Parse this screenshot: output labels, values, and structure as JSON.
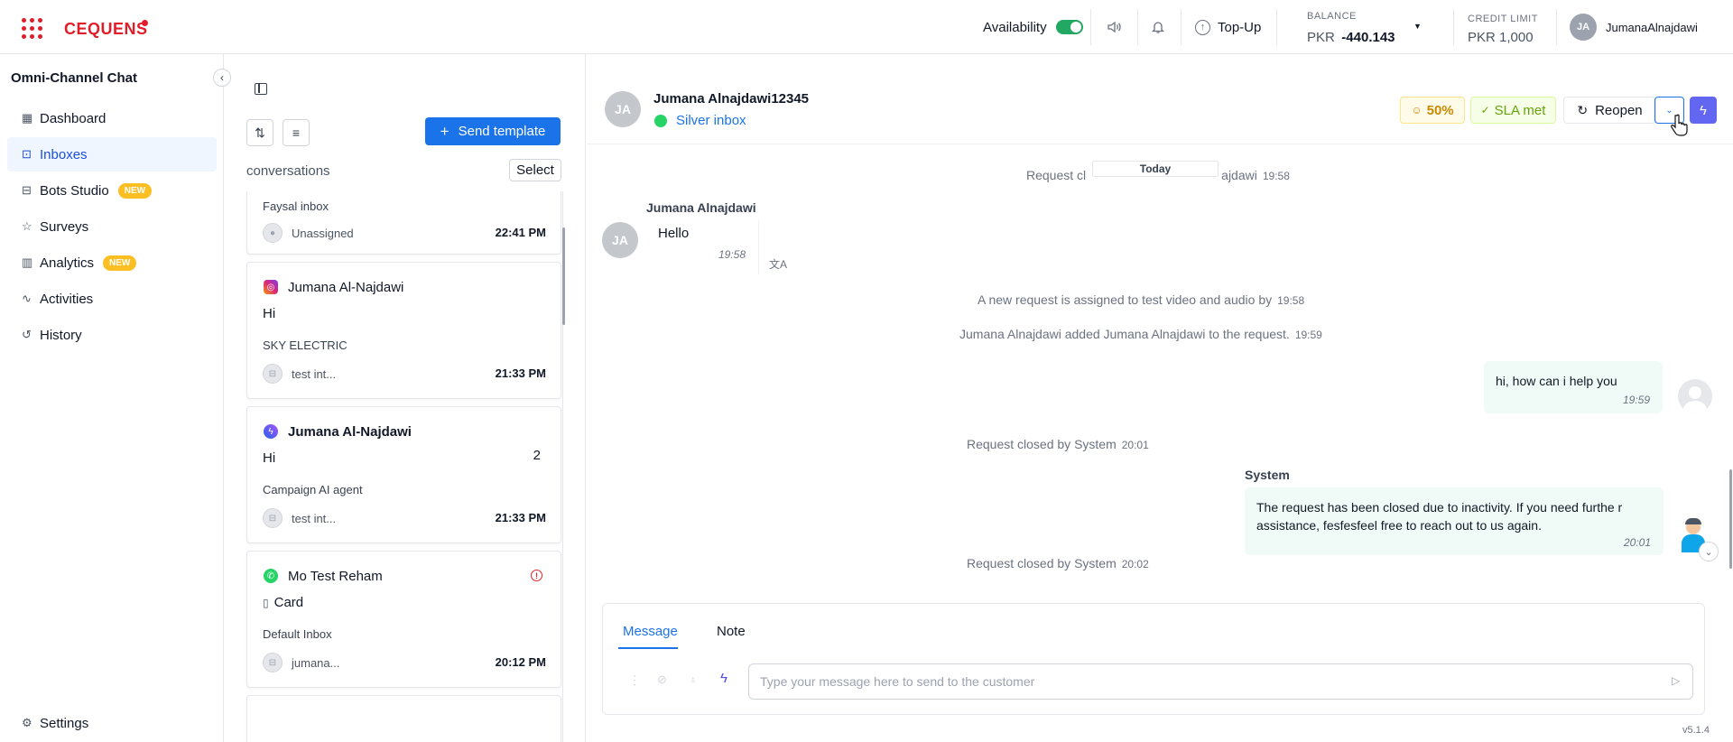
{
  "brand": {
    "name": "CEQUENS"
  },
  "topbar": {
    "availability_label": "Availability",
    "topup_label": "Top-Up",
    "balance_label": "BALANCE",
    "balance_currency": "PKR",
    "balance_value": "-440.143",
    "credit_label": "CREDIT LIMIT",
    "credit_value": "PKR 1,000",
    "user_initials": "JA",
    "user_name": "JumanaAlnajdawi"
  },
  "sidebar": {
    "title": "Omni-Channel Chat",
    "items": [
      {
        "label": "Dashboard",
        "icon": "dashboard-icon"
      },
      {
        "label": "Inboxes",
        "icon": "inbox-icon",
        "active": true
      },
      {
        "label": "Bots Studio",
        "icon": "bot-icon",
        "badge": "NEW"
      },
      {
        "label": "Surveys",
        "icon": "star-icon"
      },
      {
        "label": "Analytics",
        "icon": "chart-icon",
        "badge": "NEW"
      },
      {
        "label": "Activities",
        "icon": "activity-icon"
      },
      {
        "label": "History",
        "icon": "history-icon"
      }
    ],
    "settings_label": "Settings"
  },
  "conversations": {
    "send_template_label": "Send template",
    "list_label": "conversations",
    "select_label": "Select",
    "items": [
      {
        "name": "",
        "inbox": "Faysal inbox",
        "agent": "Unassigned",
        "time": "22:41 PM"
      },
      {
        "name": "Jumana Al-Najdawi",
        "channel": "instagram",
        "message": "Hi",
        "inbox": "SKY ELECTRIC",
        "agent": "test int...",
        "time": "21:33 PM"
      },
      {
        "name": "Jumana Al-Najdawi",
        "channel": "messenger",
        "message": "Hi",
        "unread": "2",
        "inbox": "Campaign AI agent",
        "agent": "test int...",
        "time": "21:33 PM"
      },
      {
        "name": "Mo Test Reham",
        "channel": "whatsapp",
        "message": "Card",
        "inbox": "Default Inbox",
        "agent": "jumana...",
        "time": "20:12 PM"
      }
    ]
  },
  "chat": {
    "contact_initials": "JA",
    "contact_name": "Jumana Alnajdawi12345",
    "inbox_name": "Silver inbox",
    "csat": "50%",
    "sla": "SLA met",
    "reopen_label": "Reopen",
    "date_divider": "Today",
    "events": [
      {
        "text": "Request cl",
        "text2": "ajdawi",
        "time": "19:58"
      },
      {
        "text": "A new request is assigned to test video and audio by",
        "time": "19:58"
      },
      {
        "text": "Jumana Alnajdawi added Jumana Alnajdawi to the request.",
        "time": "19:59"
      },
      {
        "text": "Request closed by System",
        "time": "20:01"
      },
      {
        "text": "Request closed by System",
        "time": "20:02"
      }
    ],
    "incoming": {
      "sender": "Jumana Alnajdawi",
      "initials": "JA",
      "text": "Hello",
      "time": "19:58"
    },
    "outgoing_agent": {
      "text": "hi, how can i help you",
      "time": "19:59"
    },
    "outgoing_system": {
      "sender": "System",
      "text": "The request has been closed due to inactivity. If you need furthe r assistance, fesfesfeel free to reach out to us again.",
      "time": "20:01"
    },
    "composer": {
      "tab_message": "Message",
      "tab_note": "Note",
      "placeholder": "Type your message here to send to the customer"
    },
    "version": "v5.1.4"
  }
}
